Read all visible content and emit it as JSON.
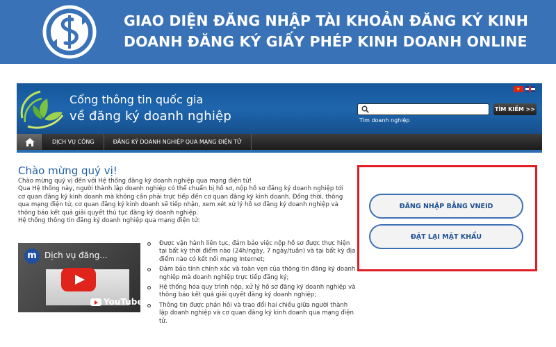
{
  "banner": {
    "title_line1": "GIAO DIỆN ĐĂNG NHẬP TÀI KHOẢN ĐĂNG KÝ KINH",
    "title_line2": "DOANH ĐĂNG KÝ GIẤY PHÉP KINH DOANH ONLINE",
    "logo_icon": "dollar-coin-icon",
    "background_color": "#3a72b7"
  },
  "site": {
    "title_line1": "Cổng thông tin quốc gia",
    "title_line2": "về đăng ký doanh nghiệp",
    "logo_icon": "leaf-swirl-icon",
    "languages": [
      "vi",
      "en"
    ],
    "search": {
      "placeholder": "",
      "button_label": "TÌM KIẾM >>",
      "caption": "Tìm doanh nghiệp"
    },
    "nav": {
      "home_icon": "home-icon",
      "items": [
        "DỊCH VỤ CÔNG",
        "ĐĂNG KÝ DOANH NGHIỆP QUA MẠNG ĐIỆN TỬ"
      ]
    }
  },
  "content": {
    "welcome": "Chào mừng quý vị!",
    "intro": [
      "Chào mừng quý vị đến với Hệ thống đăng ký doanh nghiệp qua mạng điện tử!",
      "Qua Hệ thống này, người thành lập doanh nghiệp có thể chuẩn bị hồ sơ, nộp hồ sơ đăng ký doanh nghiệp tới cơ quan đăng ký kinh doanh mà không cần phải trực tiếp đến cơ quan đăng ký kinh doanh. Đồng thời, thông qua mạng điện tử, cơ quan đăng ký kinh doanh sẽ tiếp nhận, xem xét xử lý hồ sơ đăng ký doanh nghiệp và thông báo kết quả giải quyết thủ tục đăng ký doanh nghiệp.",
      "Hệ thống thông tin đăng ký doanh nghiệp qua mạng điện tử:"
    ],
    "video": {
      "channel_initial": "m",
      "title": "Dịch vụ đăng...",
      "platform": "YouTube"
    },
    "bullets": [
      "Được vận hành liên tục, đảm bảo việc nộp hồ sơ được thực hiện tại bất kỳ thời điểm nào (24h/ngày, 7 ngày/tuần) và tại bất kỳ địa điểm nào có kết nối mạng Internet;",
      "Đảm bảo tính chính xác và toàn vẹn của thông tin đăng ký doanh nghiệp mà doanh nghiệp trực tiếp đăng ký;",
      "Hệ thống hóa quy trình nộp, xử lý hồ sơ đăng ký doanh nghiệp và thông báo kết quả giải quyết đăng ký doanh nghiệp;",
      "Thông tin được phản hồi và trao đổi hai chiều giữa người thành lập doanh nghiệp và cơ quan đăng ký kinh doanh qua mạng điện tử."
    ]
  },
  "login": {
    "vneid_label": "ĐĂNG NHẬP BẰNG VNEID",
    "reset_label": "ĐẶT LẠI MẬT KHẨU",
    "highlight_color": "#e11c23"
  }
}
